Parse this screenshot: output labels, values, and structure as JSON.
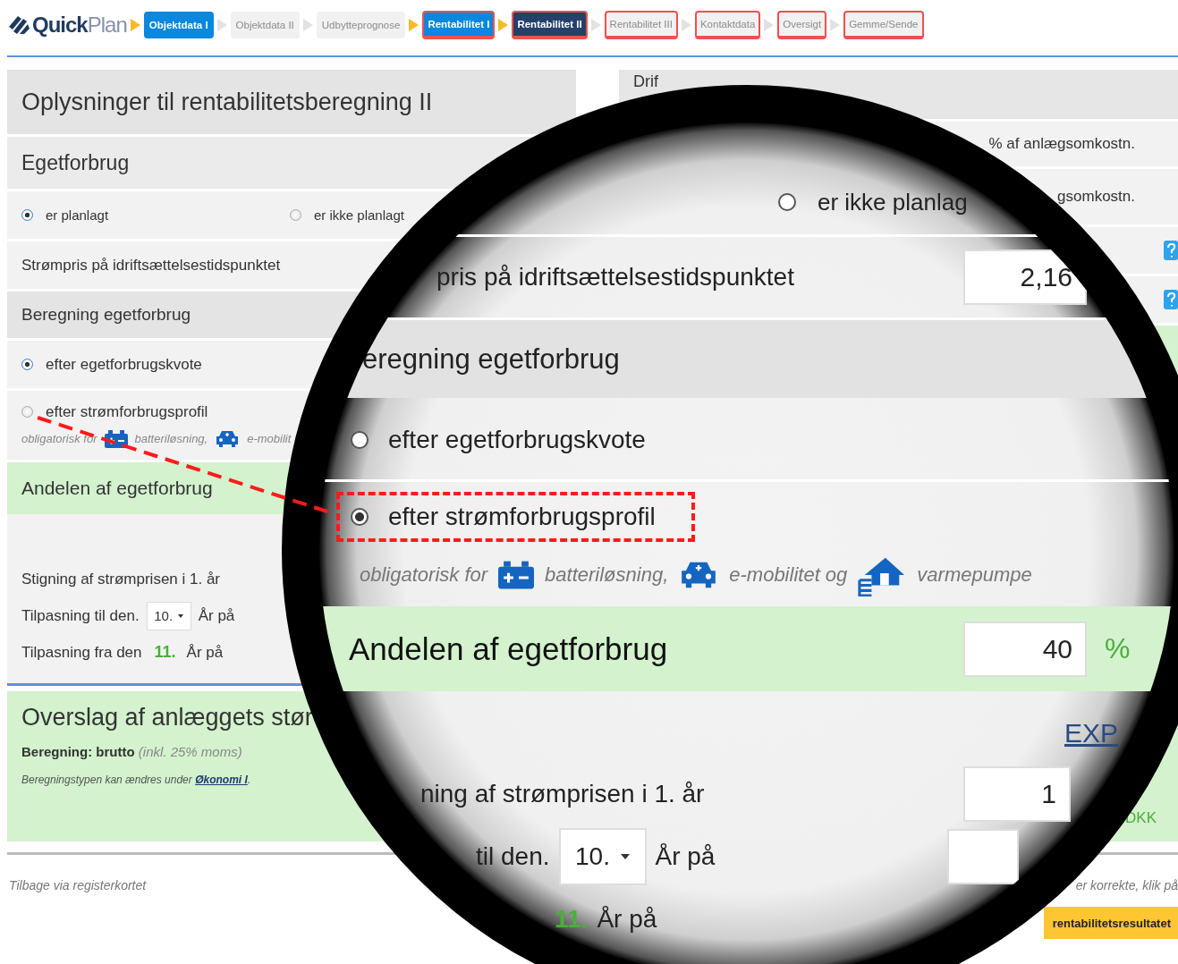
{
  "nav": {
    "logo": {
      "bold": "Quick",
      "light": "Plan"
    },
    "steps": [
      {
        "label": "Objektdata I",
        "kind": "complete",
        "warning": false,
        "selected": false
      },
      {
        "label": "Objektdata II",
        "kind": "inactive",
        "warning": false,
        "selected": false
      },
      {
        "label": "Udbytteprognose",
        "kind": "inactive",
        "warning": false,
        "selected": false
      },
      {
        "label": "Rentabilitet I",
        "kind": "complete",
        "warning": true,
        "selected": false
      },
      {
        "label": "Rentabilitet II",
        "kind": "complete",
        "warning": true,
        "selected": true
      },
      {
        "label": "Rentabilitet III",
        "kind": "inactive",
        "warning": true,
        "selected": false
      },
      {
        "label": "Kontaktdata",
        "kind": "inactive",
        "warning": true,
        "selected": false
      },
      {
        "label": "Oversigt",
        "kind": "inactive",
        "warning": true,
        "selected": false
      },
      {
        "label": "Gemme/Sende",
        "kind": "inactive",
        "warning": true,
        "selected": false
      }
    ]
  },
  "left": {
    "title": "Oplysninger til rentabilitetsberegning II",
    "own_use": {
      "heading": "Egetforbrug",
      "options": [
        {
          "label": "er planlagt",
          "selected": true
        },
        {
          "label": "er ikke planlagt",
          "selected": false
        }
      ]
    },
    "price_label": "Strømpris på idriftsættelsestidspunktet",
    "calculation": {
      "heading": "Beregning egetforbrug",
      "options": [
        {
          "label": "efter egetforbrugskvote",
          "selected": true
        },
        {
          "label": "efter strømforbrugsprofil",
          "selected": false
        }
      ],
      "note": {
        "lead": "obligatorisk for",
        "items": [
          {
            "kind": "battery",
            "label": "batteriløsning,"
          },
          {
            "kind": "car",
            "label": "e-mobilit"
          }
        ]
      }
    },
    "share_heading": "Andelen af egetforbrug",
    "rise_label": "Stigning af strømprisen i 1. år",
    "adjust_to": {
      "label": "Tilpasning til den.",
      "select": "10.",
      "suffix": "År på"
    },
    "adjust_from": {
      "label": "Tilpasning fra den",
      "value": "11.",
      "suffix": "År på"
    }
  },
  "estimate": {
    "title": "Overslag af anlæggets stør",
    "calc_label": "Beregning: brutto",
    "calc_note": "(inkl. 25% moms)",
    "hint": {
      "text": "Beregningstypen kan ændres under",
      "link": "Økonomi I",
      "tail": "."
    },
    "currency": "DKK"
  },
  "right": {
    "title": "Drif",
    "rows": [
      {
        "unit": "% af anlægsomkostn."
      },
      {
        "unit": "gsomkostn."
      }
    ]
  },
  "footer": {
    "back": "Tilbage via registerkortet",
    "hint": "er korrekte, klik på",
    "button": "rentabilitetsresultatet"
  },
  "lens": {
    "own_use_option": {
      "label": "er ikke planlag",
      "selected": false
    },
    "price_label": "pris på idriftsættelsestidspunktet",
    "price_value": "2,16",
    "calc_heading": "eregning egetforbrug",
    "options": [
      {
        "label": "efter egetforbrugskvote",
        "selected": false,
        "highlighted": false
      },
      {
        "label": "efter strømforbrugsprofil",
        "selected": true,
        "highlighted": true
      }
    ],
    "note": {
      "lead": "obligatorisk for",
      "items": [
        {
          "kind": "battery",
          "label": "batteriløsning,"
        },
        {
          "kind": "car",
          "label": "e-mobilitet og"
        },
        {
          "kind": "heat-pump",
          "label": "varmepumpe"
        }
      ]
    },
    "share": {
      "heading": "Andelen af egetforbrug",
      "value": "40",
      "unit": "%"
    },
    "export_link": "EXP",
    "rise": {
      "label": "ning af strømprisen i 1. år",
      "value": "1"
    },
    "adjust_to": {
      "label": "til den.",
      "select": "10.",
      "suffix": "År på"
    },
    "adjust_from": {
      "value": "11.",
      "suffix": "År på"
    }
  }
}
